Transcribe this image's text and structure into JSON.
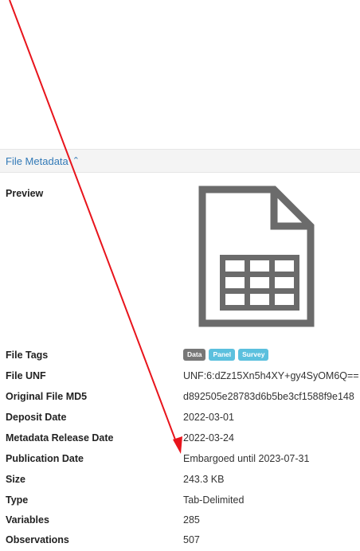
{
  "section": {
    "title": "File Metadata",
    "chevron": "⌃"
  },
  "preview": {
    "label": "Preview",
    "icon": "tabular-file-icon"
  },
  "tags": {
    "label": "File Tags",
    "items": [
      "Data",
      "Panel",
      "Survey"
    ]
  },
  "fields": [
    {
      "label": "File UNF",
      "value": "UNF:6:dZz15Xn5h4XY+gy4SyOM6Q=="
    },
    {
      "label": "Original File MD5",
      "value": "d892505e28783d6b5be3cf1588f9e148"
    },
    {
      "label": "Deposit Date",
      "value": "2022-03-01"
    },
    {
      "label": "Metadata Release Date",
      "value": "2022-03-24"
    },
    {
      "label": "Publication Date",
      "value": "Embargoed until 2023-07-31"
    },
    {
      "label": "Size",
      "value": "243.3 KB"
    },
    {
      "label": "Type",
      "value": "Tab-Delimited"
    },
    {
      "label": "Variables",
      "value": "285"
    },
    {
      "label": "Observations",
      "value": "507"
    }
  ],
  "colors": {
    "link": "#337ab7",
    "tag_data": "#777777",
    "tag_blue": "#5bc0de",
    "arrow": "#e8141c"
  }
}
